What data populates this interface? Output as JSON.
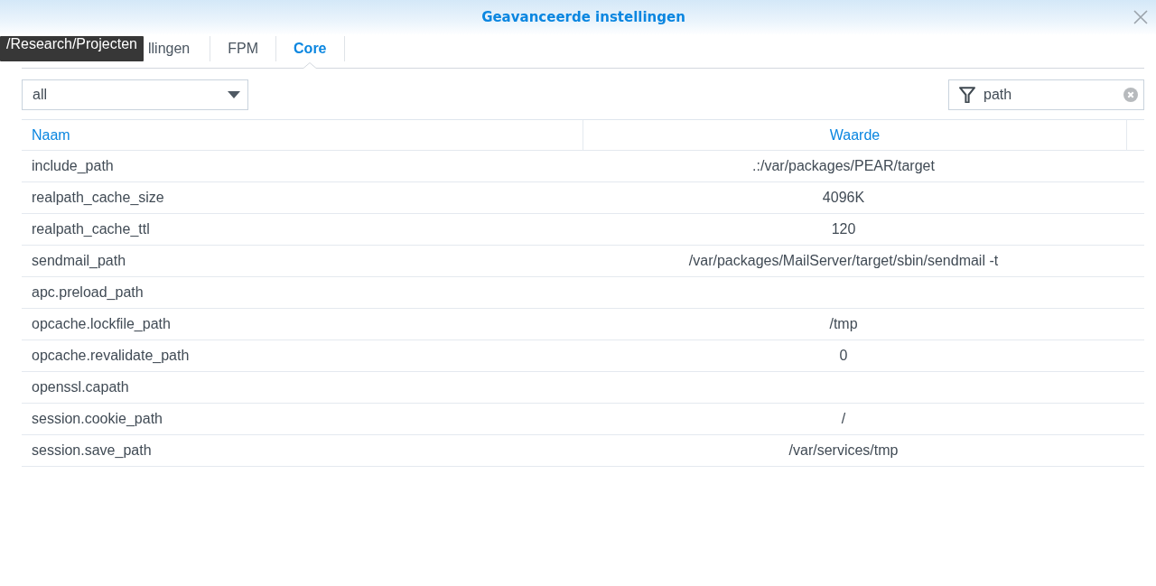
{
  "window": {
    "title": "Geavanceerde instellingen"
  },
  "tooltip": {
    "text": "/Research/Projecten"
  },
  "tabs": [
    {
      "label": "llingen",
      "selected": false
    },
    {
      "label": "FPM",
      "selected": false
    },
    {
      "label": "Core",
      "selected": true
    }
  ],
  "filter_dropdown": {
    "value": "all"
  },
  "search": {
    "value": "path"
  },
  "table": {
    "columns": [
      "Naam",
      "Waarde"
    ],
    "rows": [
      {
        "name": "include_path",
        "value": ".:/var/packages/PEAR/target"
      },
      {
        "name": "realpath_cache_size",
        "value": "4096K"
      },
      {
        "name": "realpath_cache_ttl",
        "value": "120"
      },
      {
        "name": "sendmail_path",
        "value": "/var/packages/MailServer/target/sbin/sendmail -t"
      },
      {
        "name": "apc.preload_path"
      },
      {
        "name": "opcache.lockfile_path",
        "value": "/tmp"
      },
      {
        "name": "opcache.revalidate_path",
        "value": "0"
      },
      {
        "name": "openssl.capath"
      },
      {
        "name": "session.cookie_path",
        "value": "/"
      },
      {
        "name": "session.save_path",
        "value": "/var/services/tmp"
      }
    ]
  }
}
